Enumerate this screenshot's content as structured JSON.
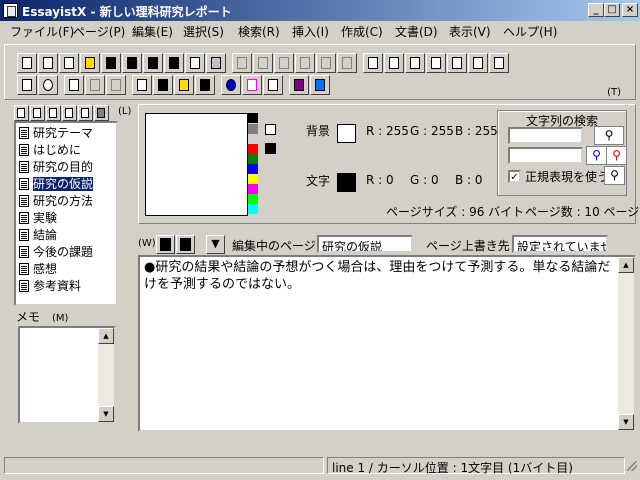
{
  "window": {
    "title": "EssayistX - 新しい理科研究レポート",
    "min_glyph": "_",
    "max_glyph": "□",
    "close_glyph": "×"
  },
  "menu": [
    {
      "label": "ファイル(F)"
    },
    {
      "label": "ページ(P)"
    },
    {
      "label": "編集(E)"
    },
    {
      "label": "選択(S)"
    },
    {
      "label": "検索(R)"
    },
    {
      "label": "挿入(I)"
    },
    {
      "label": "作成(C)"
    },
    {
      "label": "文書(D)"
    },
    {
      "label": "表示(V)"
    },
    {
      "label": "ヘルプ(H)"
    }
  ],
  "toolbar": {
    "shortcut": "(T)"
  },
  "tree": {
    "shortcut": "(L)",
    "items": [
      {
        "label": "研究テーマ"
      },
      {
        "label": "はじめに"
      },
      {
        "label": "研究の目的"
      },
      {
        "label": "研究の仮説"
      },
      {
        "label": "研究の方法"
      },
      {
        "label": "実験"
      },
      {
        "label": "結論"
      },
      {
        "label": "今後の課題"
      },
      {
        "label": "感想"
      },
      {
        "label": "参考資料"
      }
    ],
    "selected_index": 3
  },
  "memo": {
    "label": "メモ",
    "shortcut": "(M)"
  },
  "colors": {
    "background_label": "背景",
    "bg_r": "R : 255",
    "bg_g": "G : 255",
    "bg_b": "B : 255",
    "text_label": "文字",
    "fg_r": "R : 0",
    "fg_g": "G : 0",
    "fg_b": "B : 0",
    "background_color": "#ffffff",
    "text_color": "#000000",
    "palette": [
      "#000000",
      "#808080",
      "#ffffff",
      "#ff0000",
      "#008000",
      "#0000ff",
      "#ffff00",
      "#ff00ff",
      "#00ff00",
      "#00ffff"
    ]
  },
  "page_info": {
    "page_size": "ページサイズ : 96 バイト",
    "page_count": "ページ数 : 10 ページ"
  },
  "search": {
    "title": "文字列の検索",
    "field1_value": "",
    "field2_value": "",
    "regex_label": "正規表現を使う",
    "regex_checked": "✓"
  },
  "edit": {
    "shortcut": "(W)",
    "editing_page_label": "編集中のページ",
    "editing_page_value": "研究の仮説",
    "overwrite_label": "ページ上書き先",
    "overwrite_value": "設定されていません"
  },
  "document": {
    "body": "●研究の結果や結論の予想がつく場合は、理由をつけて予測する。単なる結論だけを予測するのではない。"
  },
  "status": {
    "cursor": "line 1 / カーソル位置 : 1文字目 (1バイト目)"
  }
}
